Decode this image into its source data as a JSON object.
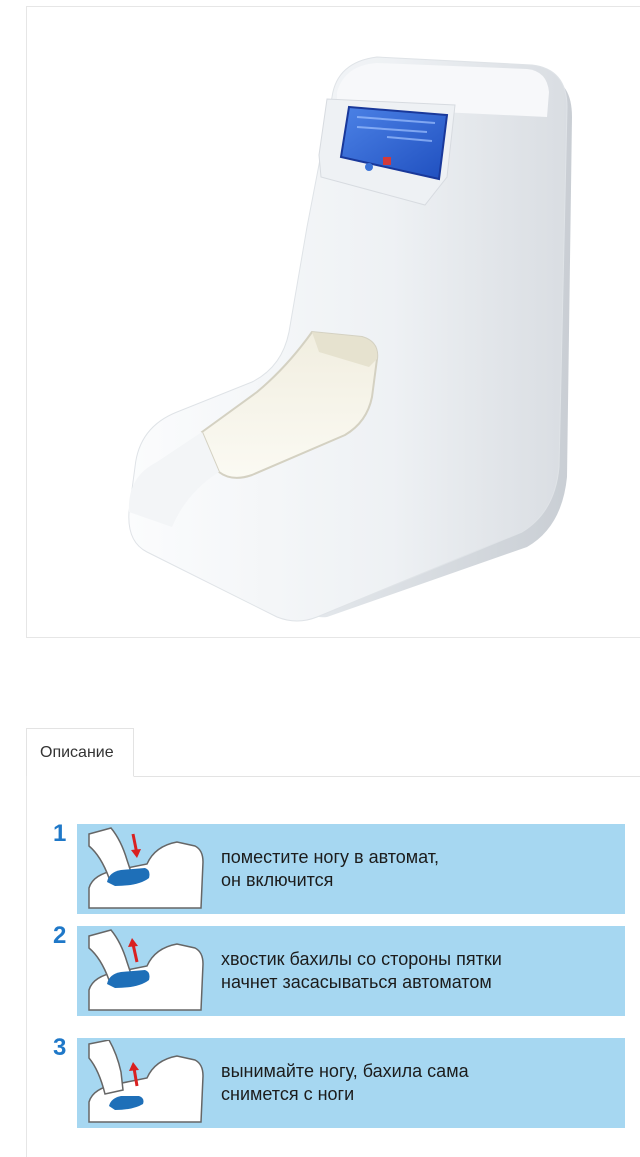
{
  "product": {
    "image_alt": "Shoe cover dispenser machine"
  },
  "tabs": [
    {
      "label": "Описание"
    }
  ],
  "steps": [
    {
      "number": "1",
      "text": "поместите ногу в автомат,\nон включится",
      "arrow": "down"
    },
    {
      "number": "2",
      "text": "хвостик бахилы со стороны пятки\nначнет засасываться автоматом",
      "arrow": "up"
    },
    {
      "number": "3",
      "text": "вынимайте ногу, бахила сама\nснимется с ноги",
      "arrow": "up"
    }
  ],
  "colors": {
    "panel": "#a6d7f1",
    "step_number": "#1f78c8",
    "shoe_cover": "#1e6fb8",
    "arrow": "#d92020",
    "screen": "#2a5bd1"
  }
}
